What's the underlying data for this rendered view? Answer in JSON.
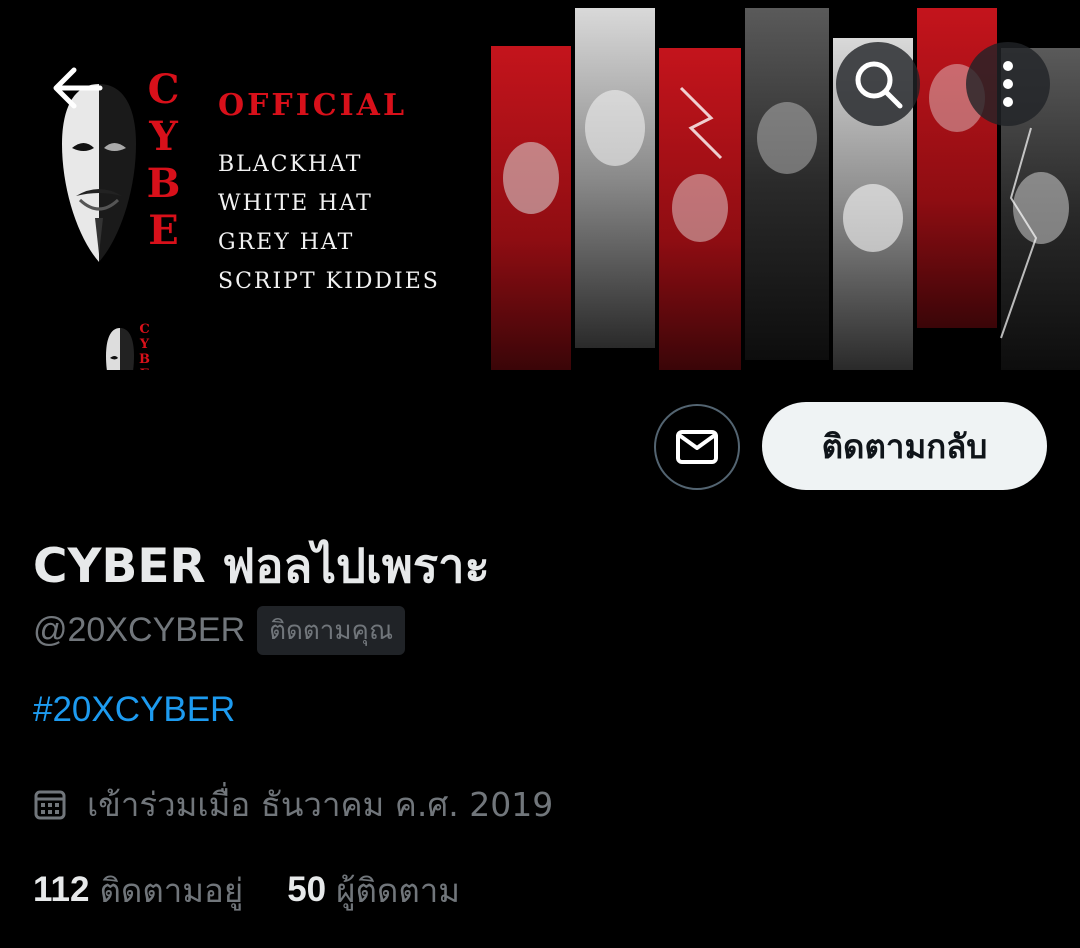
{
  "banner": {
    "brand_vertical": "CYBE",
    "brand_small": "CYBER",
    "official": "OFFICIAL",
    "hat_list": [
      "BLACKHAT",
      "WHITE HAT",
      "GREY HAT",
      "SCRIPT KIDDIES"
    ]
  },
  "nav": {
    "back_icon": "arrow-left-icon",
    "search_icon": "search-icon",
    "more_icon": "more-vertical-icon"
  },
  "actions": {
    "message_icon": "envelope-icon",
    "follow_back_label": "ติดตามกลับ"
  },
  "profile": {
    "display_name": "CYBER ฟอลไปเพราะ",
    "handle": "@20XCYBER",
    "follows_you": "ติดตามคุณ",
    "bio_hashtag": "#20XCYBER",
    "joined": "เข้าร่วมเมื่อ ธันวาคม ค.ศ. 2019",
    "following_count": "112",
    "following_label": "ติดตามอยู่",
    "followers_count": "50",
    "followers_label": "ผู้ติดตาม"
  },
  "colors": {
    "background": "#000000",
    "accent_link": "#1d9bf0",
    "banner_red": "#d8101a",
    "muted_text": "#71767b",
    "primary_text": "#e7e9ea"
  }
}
